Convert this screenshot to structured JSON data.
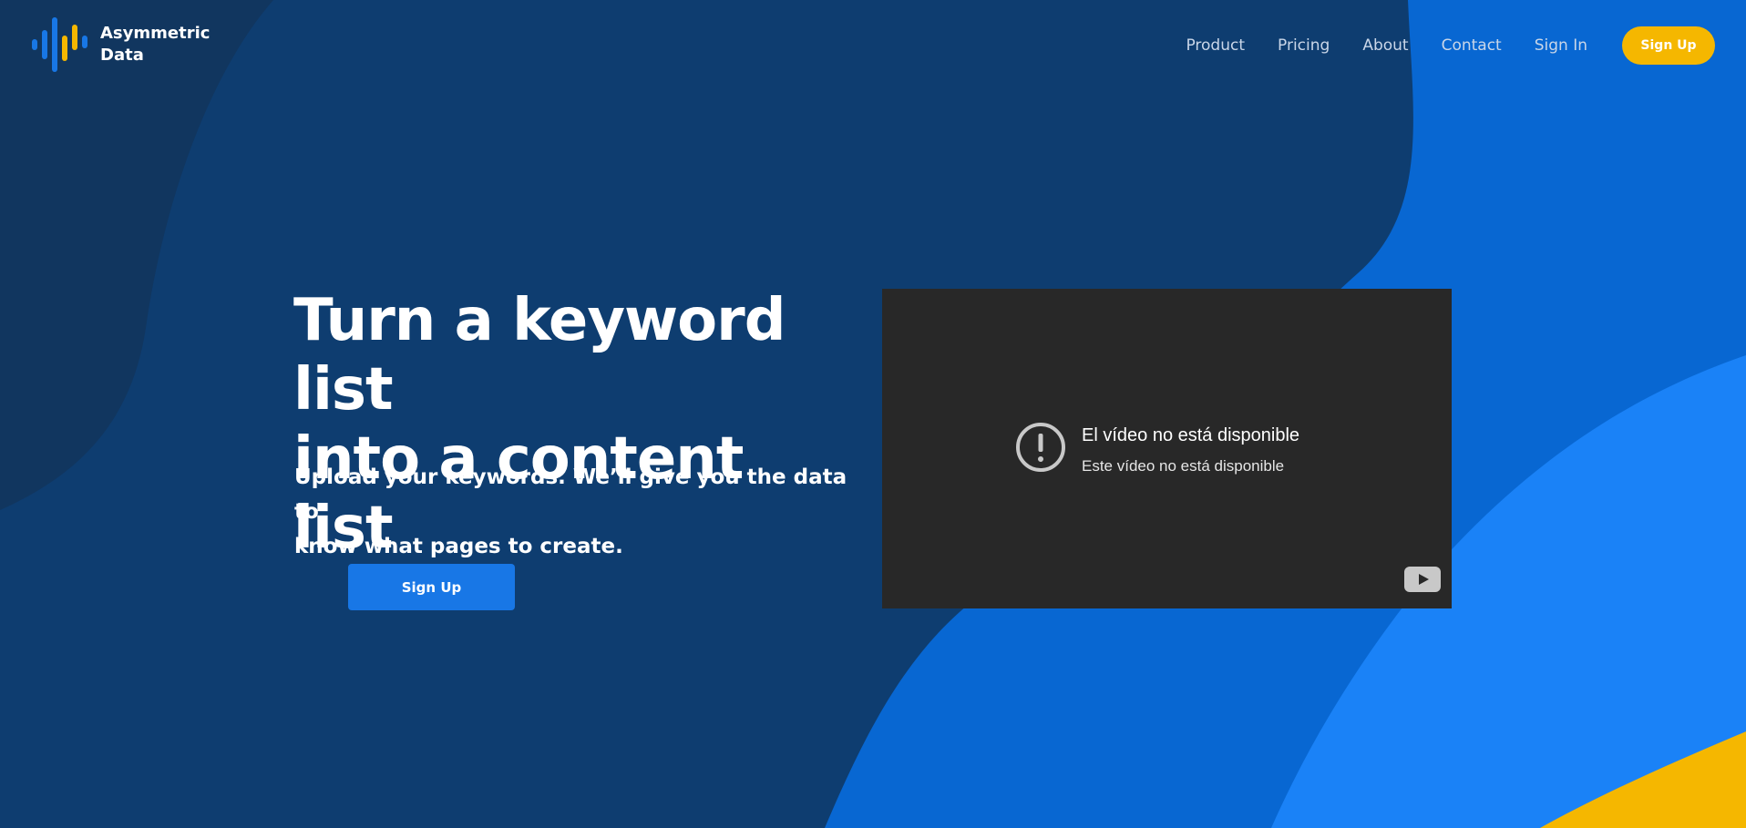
{
  "header": {
    "brand_line1": "Asymmetric",
    "brand_line2": "Data",
    "nav": [
      {
        "label": "Product"
      },
      {
        "label": "Pricing"
      },
      {
        "label": "About"
      },
      {
        "label": "Contact"
      },
      {
        "label": "Sign In"
      }
    ],
    "signup_label": "Sign Up"
  },
  "hero": {
    "title_line1": "Turn a keyword list",
    "title_line2": "into a content list",
    "subtitle_line1": "Upload your keywords. We’ll give you the data to",
    "subtitle_line2": "know what pages to create.",
    "cta_label": "Sign Up"
  },
  "video": {
    "error_title": "El vídeo no está disponible",
    "error_message": "Este vídeo no está disponible",
    "alert_icon": "alert-circle-icon",
    "play_icon": "youtube-play-icon"
  },
  "colors": {
    "background_dark": "#0e3d70",
    "blue_mid": "#0867d2",
    "blue_light": "#1a82f7",
    "accent_yellow": "#f5b700",
    "cta_blue": "#1877e6",
    "video_bg": "#282828"
  }
}
